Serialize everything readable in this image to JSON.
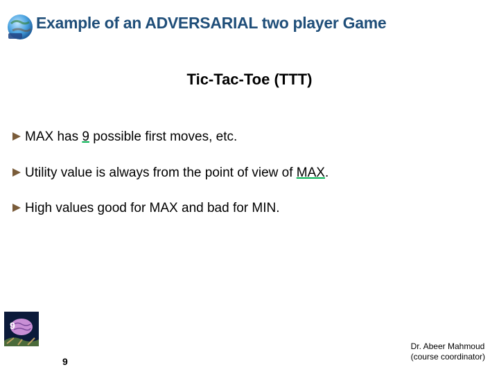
{
  "title": "Example of an ADVERSARIAL two player Game",
  "subtitle": "Tic-Tac-Toe (TTT)",
  "bullets": [
    {
      "pre": "MAX has ",
      "hl": "9",
      "post": " possible first moves, etc."
    },
    {
      "pre": "Utility value is always from the point of view of ",
      "hl": "MAX",
      "post": "."
    },
    {
      "pre": "High values good for MAX and bad for MIN.",
      "hl": "",
      "post": ""
    }
  ],
  "page_overlay": "9",
  "page_bottom": "9",
  "footer": {
    "name": "Dr. Abeer Mahmoud",
    "role": "(course coordinator)"
  }
}
